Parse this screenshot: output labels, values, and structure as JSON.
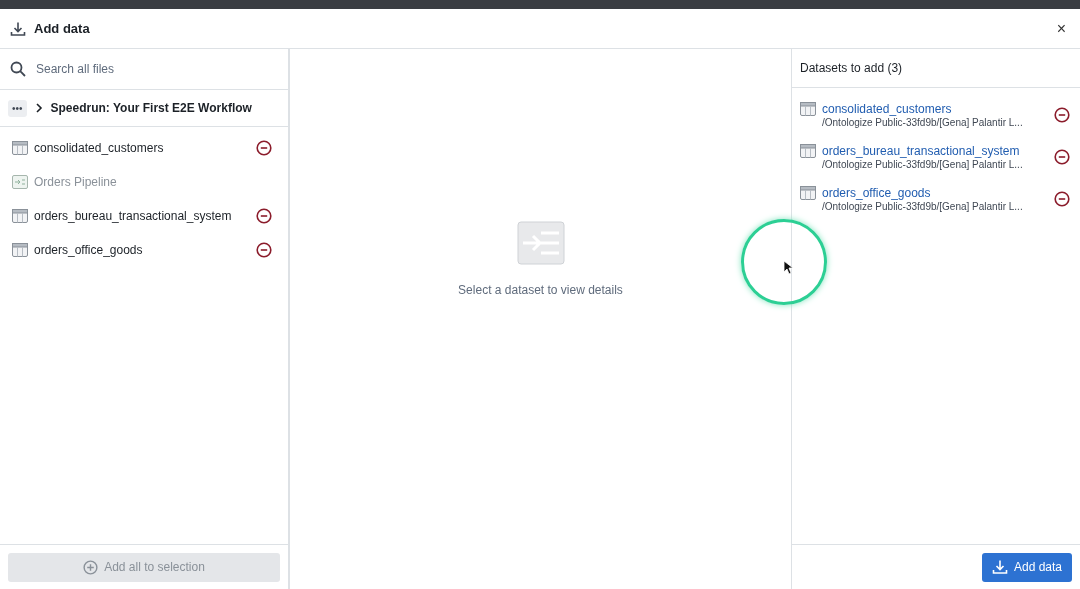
{
  "dialog": {
    "title": "Add data",
    "close": "×"
  },
  "search": {
    "placeholder": "Search all files"
  },
  "breadcrumb": {
    "more": "•••",
    "folder": "Speedrun: Your First E2E Workflow"
  },
  "files": [
    {
      "name": "consolidated_customers",
      "kind": "dataset",
      "added": true
    },
    {
      "name": "Orders Pipeline",
      "kind": "pipeline",
      "added": false
    },
    {
      "name": "orders_bureau_transactional_system",
      "kind": "dataset",
      "added": true
    },
    {
      "name": "orders_office_goods",
      "kind": "dataset",
      "added": true
    }
  ],
  "add_all_button": {
    "label": "Add all to selection",
    "disabled": true
  },
  "details": {
    "empty_text": "Select a dataset to view details"
  },
  "selection": {
    "title": "Datasets to add (3)",
    "items": [
      {
        "name": "consolidated_customers",
        "path": "/Ontologize Public-33fd9b/[Gena] Palantir L..."
      },
      {
        "name": "orders_bureau_transactional_system",
        "path": "/Ontologize Public-33fd9b/[Gena] Palantir L..."
      },
      {
        "name": "orders_office_goods",
        "path": "/Ontologize Public-33fd9b/[Gena] Palantir L..."
      }
    ]
  },
  "add_button": {
    "label": "Add data"
  }
}
